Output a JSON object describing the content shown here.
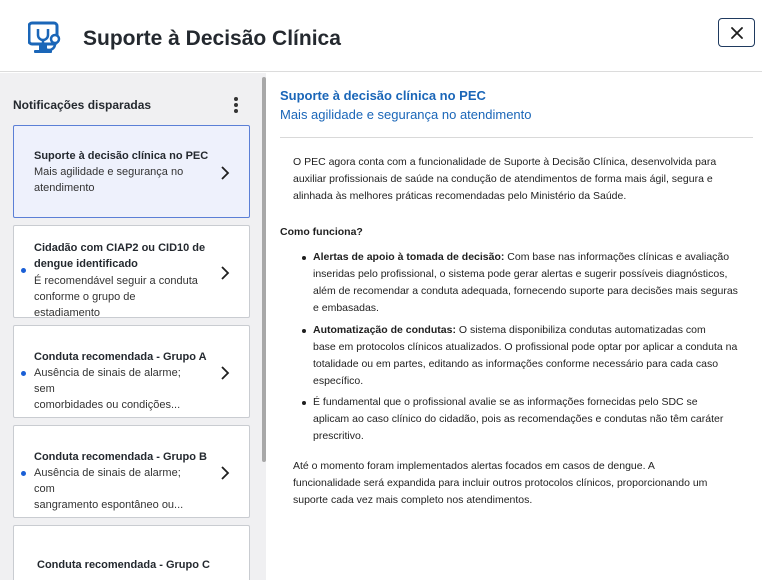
{
  "header": {
    "title": "Suporte à Decisão Clínica",
    "close_label": "✕"
  },
  "sidebar": {
    "title": "Notificações disparadas",
    "cards": [
      {
        "title": "Suporte à decisão clínica no PEC",
        "desc_lines": [
          "Mais agilidade e segurança no",
          "atendimento"
        ],
        "unread": false
      },
      {
        "title_lines": [
          "Cidadão com CIAP2 ou CID10 de",
          "dengue identificado"
        ],
        "desc_lines": [
          "É recomendável seguir a conduta",
          "conforme o grupo de estadiamento"
        ],
        "unread": true
      },
      {
        "title": "Conduta recomendada - Grupo A",
        "desc_lines": [
          "Ausência de sinais de alarme; sem",
          "comorbidades ou condições..."
        ],
        "unread": true
      },
      {
        "title": "Conduta recomendada - Grupo B",
        "desc_lines": [
          "Ausência de sinais de alarme; com",
          "sangramento espontâneo ou..."
        ],
        "unread": true
      },
      {
        "title": "Conduta recomendada - Grupo C",
        "desc_lines": [],
        "unread": false
      }
    ]
  },
  "main": {
    "title": "Suporte à decisão clínica no PEC",
    "subtitle": "Mais agilidade e segurança no atendimento",
    "intro_lines": [
      "O PEC agora conta com a funcionalidade de Suporte à Decisão Clínica, desenvolvida para",
      "auxiliar profissionais de saúde na condução de atendimentos de forma mais ágil, segura e",
      "alinhada às melhores práticas recomendadas pelo Ministério da Saúde."
    ],
    "how_heading": "Como funciona?",
    "bullets": [
      {
        "lead": "Alertas de apoio à tomada de decisão:",
        "first_line_rest": " Com base nas informações clínicas e avaliação",
        "lines": [
          "inseridas pelo profissional, o sistema pode gerar alertas e sugerir possíveis diagnósticos,",
          "além de recomendar a conduta adequada, fornecendo suporte para decisões mais seguras",
          "e embasadas."
        ]
      },
      {
        "lead": "Automatização de condutas:",
        "first_line_rest": " O sistema disponibiliza condutas automatizadas com",
        "lines": [
          "base em protocolos clínicos atualizados. O profissional pode optar por aplicar a conduta na",
          "totalidade ou em partes, editando as informações conforme necessário para cada caso",
          "específico."
        ]
      },
      {
        "lead": "",
        "first_line_rest": "É fundamental que o profissional avalie se as informações fornecidas pelo SDC se",
        "lines": [
          "aplicam ao caso clínico do cidadão, pois as recomendações e condutas não têm caráter",
          "prescritivo."
        ]
      }
    ],
    "outro_lines": [
      "Até o momento foram implementados alertas focados em casos de dengue. A",
      "funcionalidade será expandida para incluir outros protocolos clínicos, proporcionando um",
      "suporte cada vez mais completo nos atendimentos."
    ]
  },
  "colors": {
    "accent": "#1a66b8",
    "selected_bg": "#eef1fc",
    "unread_dot": "#1a5fd6"
  }
}
